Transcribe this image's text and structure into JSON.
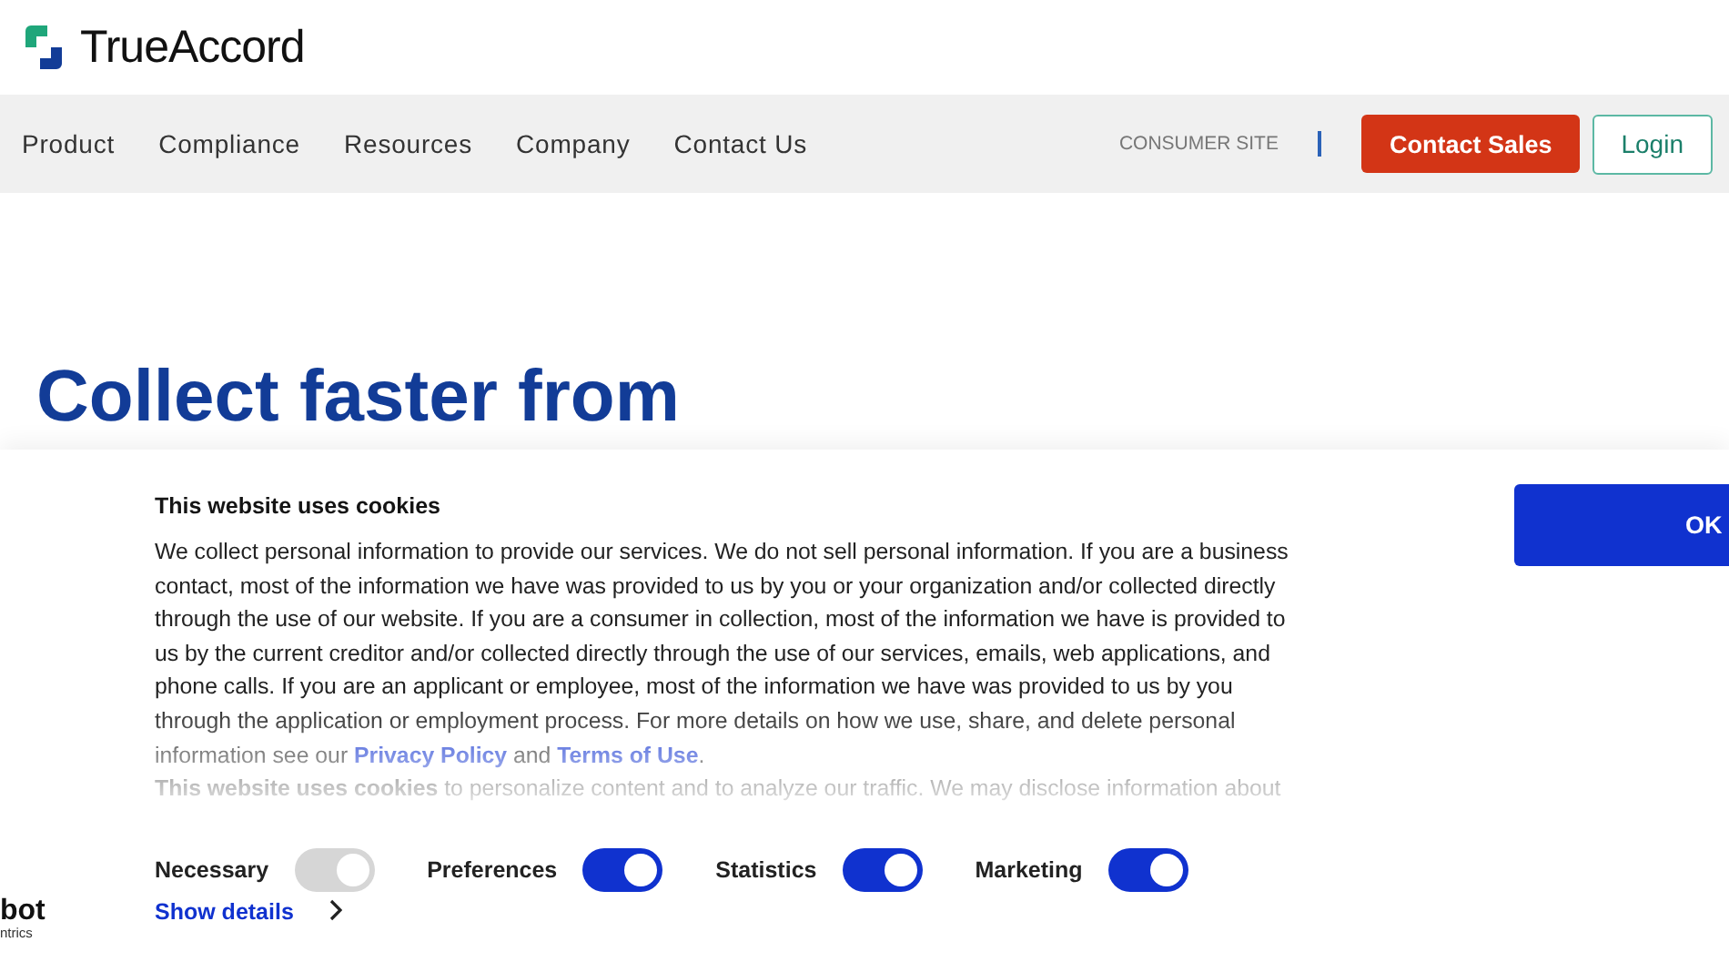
{
  "header": {
    "brand": "TrueAccord"
  },
  "nav": {
    "items": [
      "Product",
      "Compliance",
      "Resources",
      "Company",
      "Contact Us"
    ],
    "consumer_link": "CONSUMER SITE",
    "contact_button": "Contact Sales",
    "login_button": "Login"
  },
  "hero": {
    "heading": "Collect faster from"
  },
  "cookie_banner": {
    "title": "This website uses cookies",
    "paragraph": "We collect personal information to provide our services. We do not sell personal information. If you are a business contact, most of the information we have was provided to us by you or your organization and/or collected directly through the use of our website. If you are a consumer in collection, most of the information we have is provided to us by the current creditor and/or collected directly through the use of our services, emails, web applications, and phone calls. If you are an applicant or employee, most of the information we have was provided to us by you through the application or employment process. For more details on how we use, share, and delete personal information see our ",
    "links": [
      "Privacy Policy",
      "Terms of Use"
    ],
    "link_joiner": " and ",
    "paragraph_end": ".",
    "paragraph_2": "**This website uses cookies** to personalize content and to analyze our traffic.  We may disclose information about",
    "toggles": [
      {
        "label": "Necessary",
        "checked": true,
        "disabled": true
      },
      {
        "label": "Preferences",
        "checked": true,
        "disabled": false
      },
      {
        "label": "Statistics",
        "checked": true,
        "disabled": false
      },
      {
        "label": "Marketing",
        "checked": true,
        "disabled": false
      }
    ],
    "show_details": "Show details",
    "ok_button": "OK",
    "logo_lines": [
      "bot",
      "ntrics"
    ]
  }
}
